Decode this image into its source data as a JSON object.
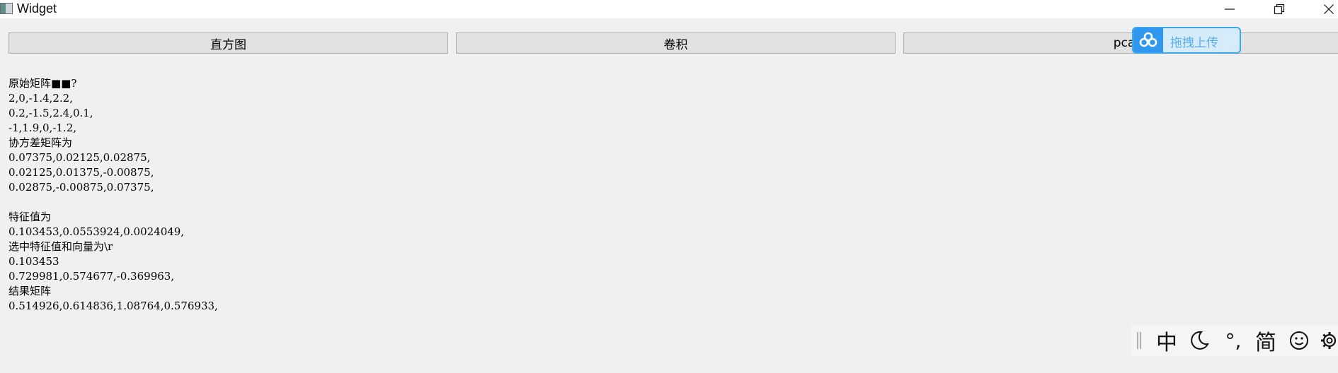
{
  "window": {
    "title": "Widget",
    "icons": {
      "app": "app-window-icon",
      "minimize": "minimize-icon",
      "maximize": "restore-icon",
      "close": "close-icon"
    }
  },
  "toolbar": {
    "histogram_label": "直方图",
    "convolution_label": "卷积",
    "pca_label": "pca"
  },
  "upload_float": {
    "label": "拖拽上传",
    "icon": "cloud-upload-icon",
    "accent": "#2f98ee"
  },
  "output": {
    "lines": [
      "原始矩阵■■?",
      "2,0,-1.4,2.2,",
      "0.2,-1.5,2.4,0.1,",
      "-1,1.9,0,-1.2,",
      "协方差矩阵为",
      "0.07375,0.02125,0.02875,",
      "0.02125,0.01375,-0.00875,",
      "0.02875,-0.00875,0.07375,",
      "",
      "特征值为",
      "0.103453,0.0553924,0.0024049,",
      "选中特征值和向量为\\r",
      "0.103453",
      "0.729981,0.574677,-0.369963,",
      "结果矩阵",
      "0.514926,0.614836,1.08764,0.576933,"
    ]
  },
  "ime": {
    "lang": "中",
    "mode_icon": "moon-icon",
    "punct": "°,",
    "script": "简",
    "emoji_icon": "smiley-icon",
    "settings_icon": "gear-icon"
  }
}
